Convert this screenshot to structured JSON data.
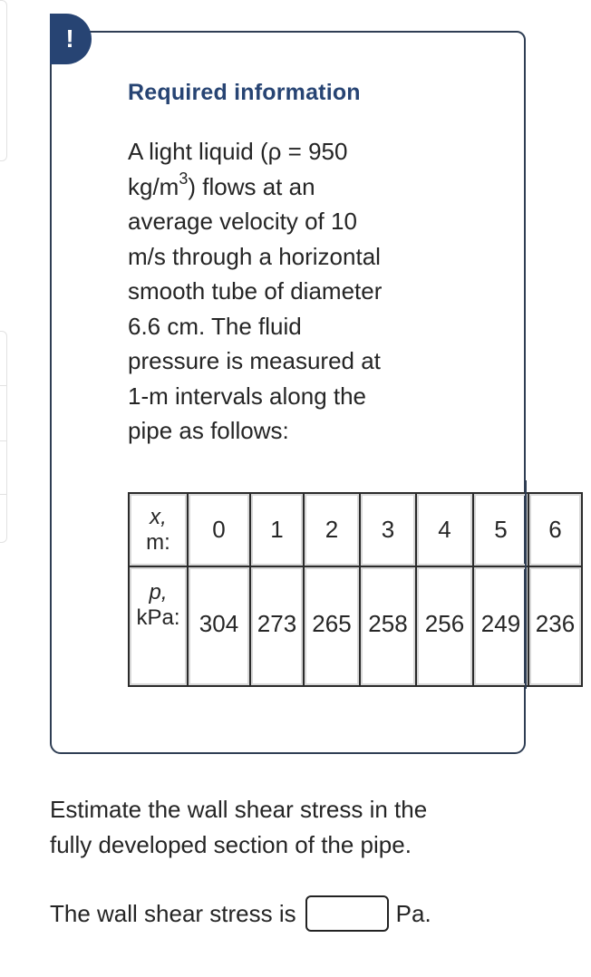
{
  "alert": {
    "icon": "exclamation-icon",
    "symbol": "!"
  },
  "card": {
    "title": "Required information",
    "body_lines": [
      "A light liquid (ρ = 950",
      "kg/m",
      "3",
      ") flows at an",
      "average velocity of 10",
      "m/s through a horizontal",
      "smooth tube of diameter",
      "6.6 cm. The fluid",
      "pressure is measured at",
      "1-m intervals along the",
      "pipe as follows:"
    ]
  },
  "table": {
    "row_x": {
      "label_var": "x,",
      "label_unit": "m:",
      "values": [
        "0",
        "1",
        "2",
        "3",
        "4",
        "5",
        "6"
      ]
    },
    "row_p": {
      "label_var": "p,",
      "label_unit": "kPa:",
      "values": [
        "304",
        "273",
        "265",
        "258",
        "256",
        "249",
        "236"
      ]
    }
  },
  "question": {
    "lines": [
      "Estimate the wall shear stress in the",
      "fully developed section of the pipe."
    ]
  },
  "answer": {
    "prefix": "The wall shear stress is",
    "value": "",
    "placeholder": "",
    "unit": "Pa."
  },
  "colors": {
    "accent": "#274473",
    "card_border": "#2f3e54",
    "text": "#252525"
  }
}
